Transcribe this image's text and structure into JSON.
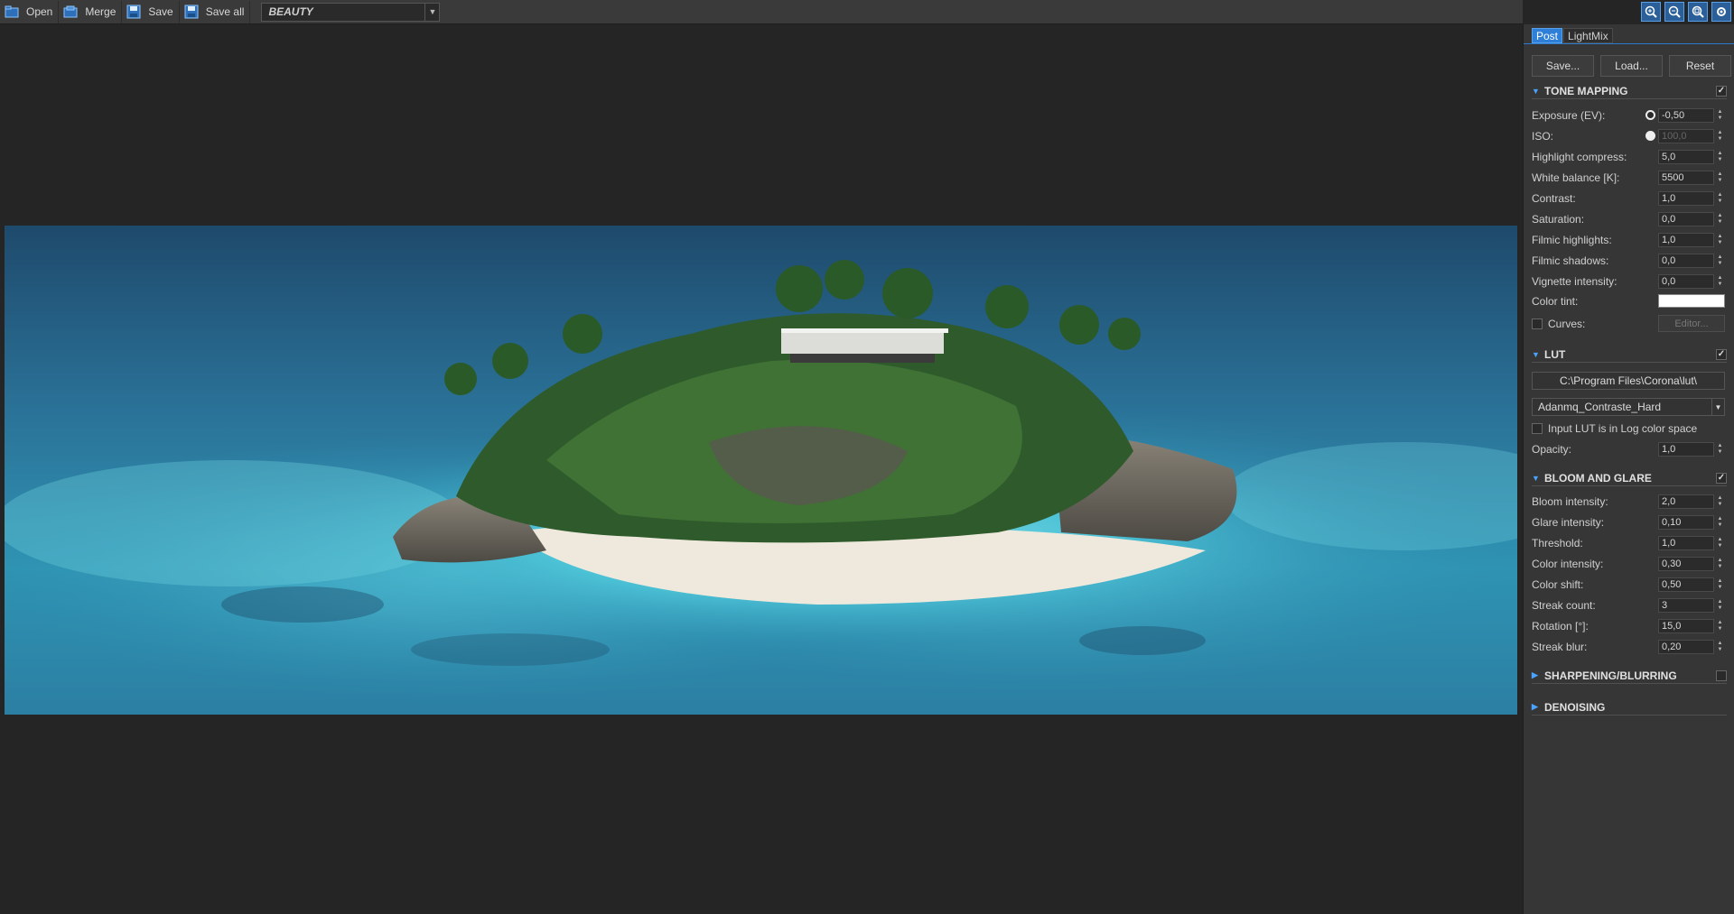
{
  "toolbar": {
    "open": "Open",
    "merge": "Merge",
    "save": "Save",
    "save_all": "Save all",
    "render_pass": "BEAUTY"
  },
  "panel": {
    "tabs": [
      "Post",
      "LightMix"
    ],
    "buttons": {
      "save": "Save...",
      "load": "Load...",
      "reset": "Reset"
    },
    "tone_mapping": {
      "title": "TONE MAPPING",
      "exposure": {
        "label": "Exposure (EV):",
        "value": "-0,50"
      },
      "iso": {
        "label": "ISO:",
        "value": "100,0"
      },
      "highlight": {
        "label": "Highlight compress:",
        "value": "5,0"
      },
      "white_balance": {
        "label": "White balance [K]:",
        "value": "5500"
      },
      "contrast": {
        "label": "Contrast:",
        "value": "1,0"
      },
      "saturation": {
        "label": "Saturation:",
        "value": "0,0"
      },
      "filmic_highlights": {
        "label": "Filmic highlights:",
        "value": "1,0"
      },
      "filmic_shadows": {
        "label": "Filmic shadows:",
        "value": "0,0"
      },
      "vignette": {
        "label": "Vignette intensity:",
        "value": "0,0"
      },
      "color_tint": {
        "label": "Color tint:",
        "color": "#ffffff"
      },
      "curves": {
        "label": "Curves:",
        "button": "Editor..."
      }
    },
    "lut": {
      "title": "LUT",
      "path": "C:\\Program Files\\Corona\\lut\\",
      "selected": "Adanmq_Contraste_Hard",
      "log_label": "Input LUT is in Log color space",
      "opacity": {
        "label": "Opacity:",
        "value": "1,0"
      }
    },
    "bloom": {
      "title": "BLOOM AND GLARE",
      "bloom_intensity": {
        "label": "Bloom intensity:",
        "value": "2,0"
      },
      "glare_intensity": {
        "label": "Glare intensity:",
        "value": "0,10"
      },
      "threshold": {
        "label": "Threshold:",
        "value": "1,0"
      },
      "color_intensity": {
        "label": "Color intensity:",
        "value": "0,30"
      },
      "color_shift": {
        "label": "Color shift:",
        "value": "0,50"
      },
      "streak_count": {
        "label": "Streak count:",
        "value": "3"
      },
      "rotation": {
        "label": "Rotation [°]:",
        "value": "15,0"
      },
      "streak_blur": {
        "label": "Streak blur:",
        "value": "0,20"
      }
    },
    "sharpening": {
      "title": "SHARPENING/BLURRING"
    },
    "denoising": {
      "title": "DENOISING"
    }
  },
  "colors": {
    "accent": "#2d7fd8",
    "panel_bg": "#363636",
    "viewport_bg": "#252525"
  }
}
